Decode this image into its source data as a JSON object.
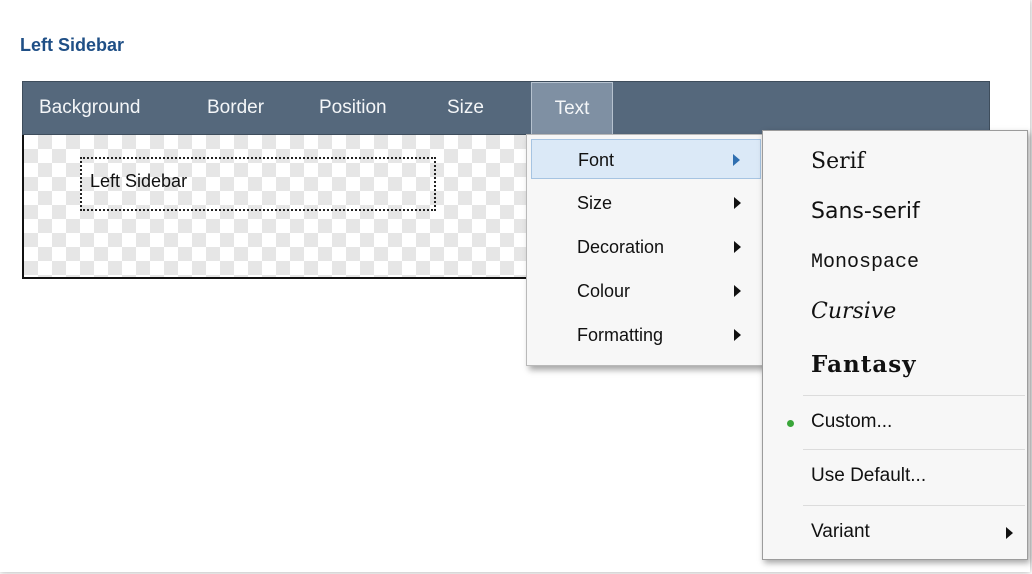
{
  "panel": {
    "title": "Left Sidebar"
  },
  "toolbar": {
    "tabs": [
      {
        "label": "Background"
      },
      {
        "label": "Border"
      },
      {
        "label": "Position"
      },
      {
        "label": "Size"
      },
      {
        "label": "Text",
        "active": true
      }
    ]
  },
  "canvas": {
    "sidebar_label": "Left Sidebar"
  },
  "text_menu": {
    "items": [
      {
        "label": "Font",
        "has_submenu": true,
        "selected": true
      },
      {
        "label": "Size",
        "has_submenu": true
      },
      {
        "label": "Decoration",
        "has_submenu": true
      },
      {
        "label": "Colour",
        "has_submenu": true
      },
      {
        "label": "Formatting",
        "has_submenu": true
      }
    ]
  },
  "font_menu": {
    "items": [
      {
        "label": "Serif"
      },
      {
        "label": "Sans-serif"
      },
      {
        "label": "Monospace"
      },
      {
        "label": "Cursive"
      },
      {
        "label": "Fantasy"
      },
      {
        "label": "Custom...",
        "checked": true
      },
      {
        "label": "Use Default..."
      },
      {
        "label": "Variant",
        "has_submenu": true
      }
    ]
  },
  "colors": {
    "title": "#1f4f86",
    "toolbar": "#55687c",
    "active_tab": "#7f90a3",
    "menu_highlight": "#dbe9f7",
    "check_dot": "#3aa63a"
  }
}
